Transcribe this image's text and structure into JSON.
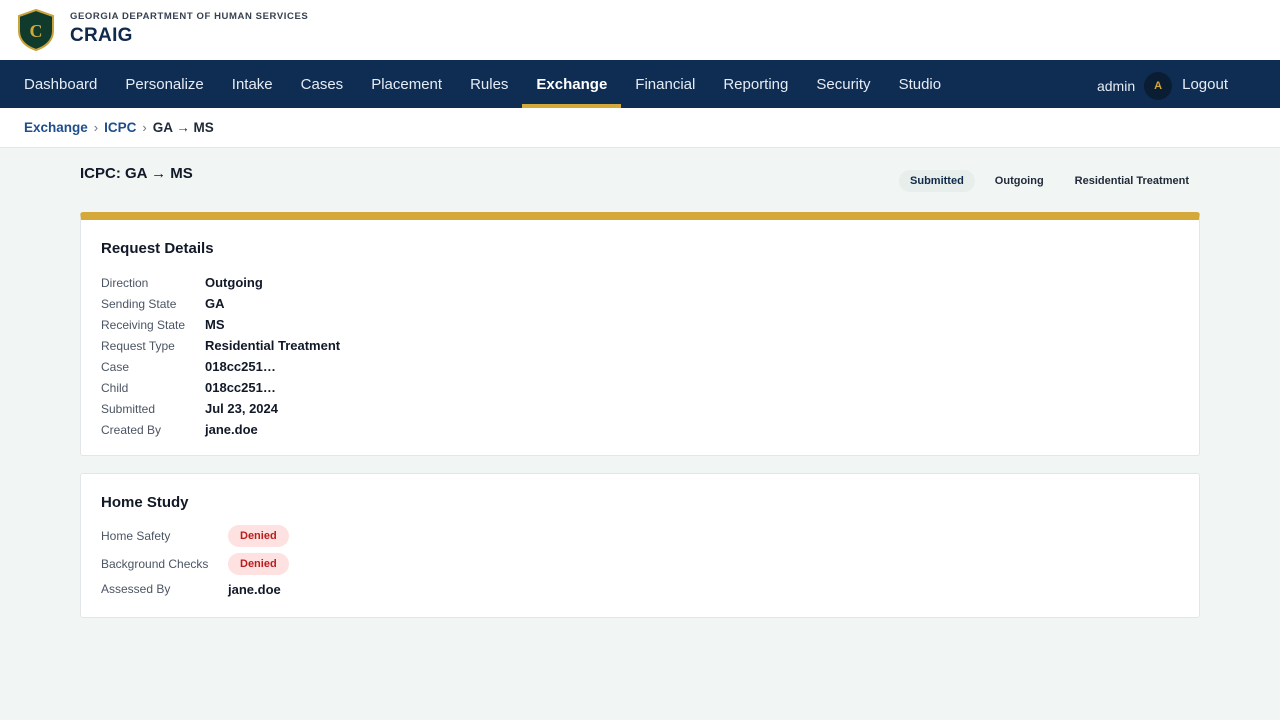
{
  "header": {
    "org_name": "GEORGIA DEPARTMENT OF HUMAN SERVICES",
    "app_name": "CRAIG",
    "logo_letter": "C"
  },
  "nav": {
    "items": [
      {
        "label": "Dashboard"
      },
      {
        "label": "Personalize"
      },
      {
        "label": "Intake"
      },
      {
        "label": "Cases"
      },
      {
        "label": "Placement"
      },
      {
        "label": "Rules"
      },
      {
        "label": "Exchange",
        "active": true
      },
      {
        "label": "Financial"
      },
      {
        "label": "Reporting"
      },
      {
        "label": "Security"
      },
      {
        "label": "Studio"
      }
    ],
    "user": "admin",
    "avatar_initial": "A",
    "logout_label": "Logout"
  },
  "breadcrumb": {
    "items": [
      "Exchange",
      "ICPC"
    ],
    "separator": "›",
    "current": "GA → MS"
  },
  "page": {
    "title": "ICPC: GA → MS",
    "chips": {
      "status": "Submitted",
      "direction": "Outgoing",
      "request_type": "Residential Treatment"
    }
  },
  "request_details": {
    "title": "Request Details",
    "rows": [
      {
        "label": "Direction",
        "value": "Outgoing"
      },
      {
        "label": "Sending State",
        "value": "GA"
      },
      {
        "label": "Receiving State",
        "value": "MS"
      },
      {
        "label": "Request Type",
        "value": "Residential Treatment"
      },
      {
        "label": "Case",
        "value": "018cc251…"
      },
      {
        "label": "Child",
        "value": "018cc251…"
      },
      {
        "label": "Submitted",
        "value": "Jul 23, 2024"
      },
      {
        "label": "Created By",
        "value": "jane.doe"
      }
    ]
  },
  "home_study": {
    "title": "Home Study",
    "home_safety": {
      "label": "Home Safety",
      "value": "Denied"
    },
    "background_checks": {
      "label": "Background Checks",
      "value": "Denied"
    },
    "assessed_by": {
      "label": "Assessed By",
      "value": "jane.doe"
    }
  },
  "colors": {
    "nav_bg": "#0f2d52",
    "accent_gold": "#d4a93a",
    "denied_bg": "#fde2e1",
    "denied_text": "#b91c1c"
  }
}
